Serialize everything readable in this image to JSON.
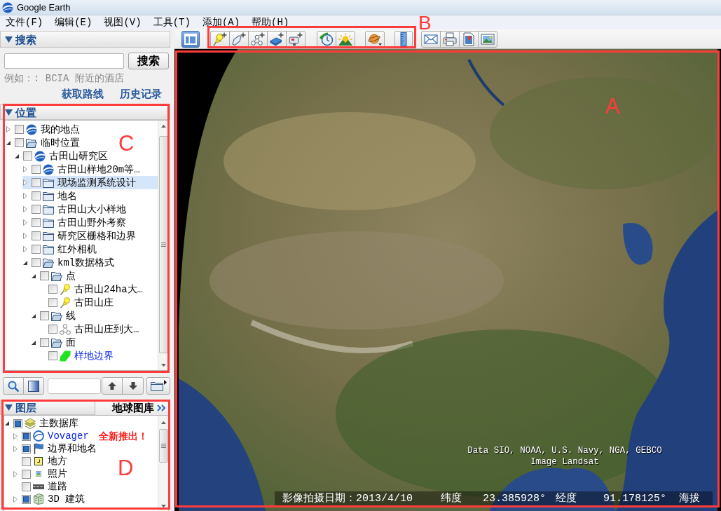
{
  "window": {
    "title": "Google Earth"
  },
  "menu": [
    "文件(F)",
    "编辑(E)",
    "视图(V)",
    "工具(T)",
    "添加(A)",
    "帮助(H)"
  ],
  "search": {
    "title": "搜索",
    "button": "搜索",
    "hint": "例如：: BCIA 附近的酒店",
    "links": [
      "获取路线",
      "历史记录"
    ]
  },
  "places": {
    "title": "位置",
    "items": [
      {
        "label": "我的地点",
        "kind": "globe",
        "expanded": false,
        "checked": false,
        "selected": false,
        "link": false
      },
      {
        "label": "临时位置",
        "kind": "open-folder",
        "expanded": true,
        "checked": false,
        "selected": false,
        "link": false,
        "children": [
          {
            "label": "古田山研究区",
            "kind": "globe",
            "expanded": true,
            "checked": false,
            "selected": false,
            "link": false,
            "children": [
              {
                "label": "古田山样地20m等…",
                "kind": "globe",
                "expanded": false,
                "checked": false,
                "selected": false,
                "link": false
              },
              {
                "label": "现场监测系统设计",
                "kind": "folder",
                "expanded": false,
                "checked": false,
                "selected": true,
                "link": false
              },
              {
                "label": "地名",
                "kind": "folder",
                "expanded": false,
                "checked": false,
                "selected": false,
                "link": false
              },
              {
                "label": "古田山大小样地",
                "kind": "folder",
                "expanded": false,
                "checked": false,
                "selected": false,
                "link": false
              },
              {
                "label": "古田山野外考察",
                "kind": "folder",
                "expanded": false,
                "checked": false,
                "selected": false,
                "link": false
              },
              {
                "label": "研究区栅格和边界",
                "kind": "folder",
                "expanded": false,
                "checked": false,
                "selected": false,
                "link": false
              },
              {
                "label": "红外相机",
                "kind": "folder",
                "expanded": false,
                "checked": false,
                "selected": false,
                "link": false
              },
              {
                "label": "kml数据格式",
                "kind": "open-folder",
                "expanded": true,
                "checked": false,
                "selected": false,
                "link": false,
                "children": [
                  {
                    "label": "点",
                    "kind": "open-folder",
                    "expanded": true,
                    "checked": false,
                    "selected": false,
                    "link": false,
                    "children": [
                      {
                        "label": "古田山24ha大…",
                        "kind": "pin",
                        "checked": false,
                        "selected": false,
                        "link": false
                      },
                      {
                        "label": "古田山庄",
                        "kind": "pin",
                        "checked": false,
                        "selected": false,
                        "link": false
                      }
                    ]
                  },
                  {
                    "label": "线",
                    "kind": "open-folder",
                    "expanded": true,
                    "checked": false,
                    "selected": false,
                    "link": false,
                    "children": [
                      {
                        "label": "古田山庄到大…",
                        "kind": "path",
                        "checked": false,
                        "selected": false,
                        "link": false
                      }
                    ]
                  },
                  {
                    "label": "面",
                    "kind": "open-folder",
                    "expanded": true,
                    "checked": false,
                    "selected": false,
                    "link": false,
                    "children": [
                      {
                        "label": "样地边界",
                        "kind": "polygon",
                        "checked": false,
                        "selected": false,
                        "link": true
                      }
                    ]
                  }
                ]
              }
            ]
          }
        ]
      }
    ]
  },
  "layers": {
    "title": "图层",
    "gallery_button": "地球图库",
    "items": [
      {
        "label": "主数据库",
        "kind": "database",
        "expanded": true,
        "checked": true,
        "selected": false,
        "link": false,
        "children": [
          {
            "label": "Vovager",
            "kind": "orbit",
            "expanded": false,
            "checked": true,
            "selected": false,
            "link": true,
            "badge": "全新推出！"
          },
          {
            "label": "边界和地名",
            "kind": "flag",
            "expanded": false,
            "checked": true,
            "selected": false,
            "link": false
          },
          {
            "label": "地方",
            "kind": "place",
            "checked": false,
            "selected": false,
            "link": false
          },
          {
            "label": "照片",
            "kind": "photo",
            "expanded": false,
            "checked": false,
            "selected": false,
            "link": false
          },
          {
            "label": "道路",
            "kind": "road",
            "checked": false,
            "selected": false,
            "link": false
          },
          {
            "label": "3D 建筑",
            "kind": "building",
            "expanded": false,
            "checked": true,
            "selected": false,
            "link": false
          }
        ]
      }
    ]
  },
  "toolbar": {
    "sidebar_button": {
      "on": true
    }
  },
  "map": {
    "attribution": [
      "Data SIO, NOAA, U.S. Navy, NGA, GEBCO",
      "Image Landsat"
    ],
    "status": {
      "date": "影像拍摄日期：2013/4/10",
      "latitude_label": "纬度",
      "latitude": "23.385928°",
      "longitude_label": "经度",
      "longitude": "91.178125°",
      "elevation_label": "海拔"
    }
  },
  "annotations": [
    {
      "label": "A"
    },
    {
      "label": "B"
    },
    {
      "label": "C"
    },
    {
      "label": "D"
    }
  ]
}
